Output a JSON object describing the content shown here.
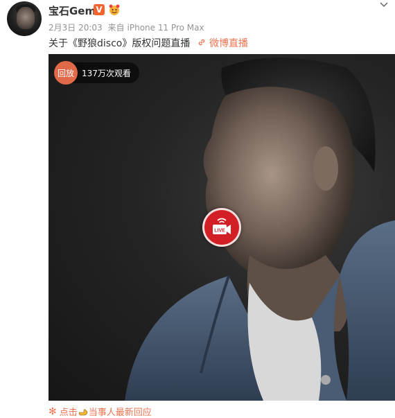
{
  "author": {
    "name": "宝石Gem",
    "verified_badge": "V",
    "emoji_badge_icon": "emoji-badge-icon"
  },
  "post": {
    "date": "2月3日 20:03",
    "source_prefix": "来自",
    "source": "iPhone 11 Pro Max",
    "text": "关于《野狼disco》版权问题直播",
    "live_link_label": "微博直播"
  },
  "media": {
    "replay_label": "回放",
    "view_count": "137万次观看",
    "live_label": "LIVE"
  },
  "footer": {
    "prefix": "点击",
    "suffix": "当事人最新回应"
  },
  "colors": {
    "accent": "#eb7350",
    "live_red": "#d21f25",
    "vip_orange": "#f7632c",
    "meta_gray": "#939393"
  }
}
